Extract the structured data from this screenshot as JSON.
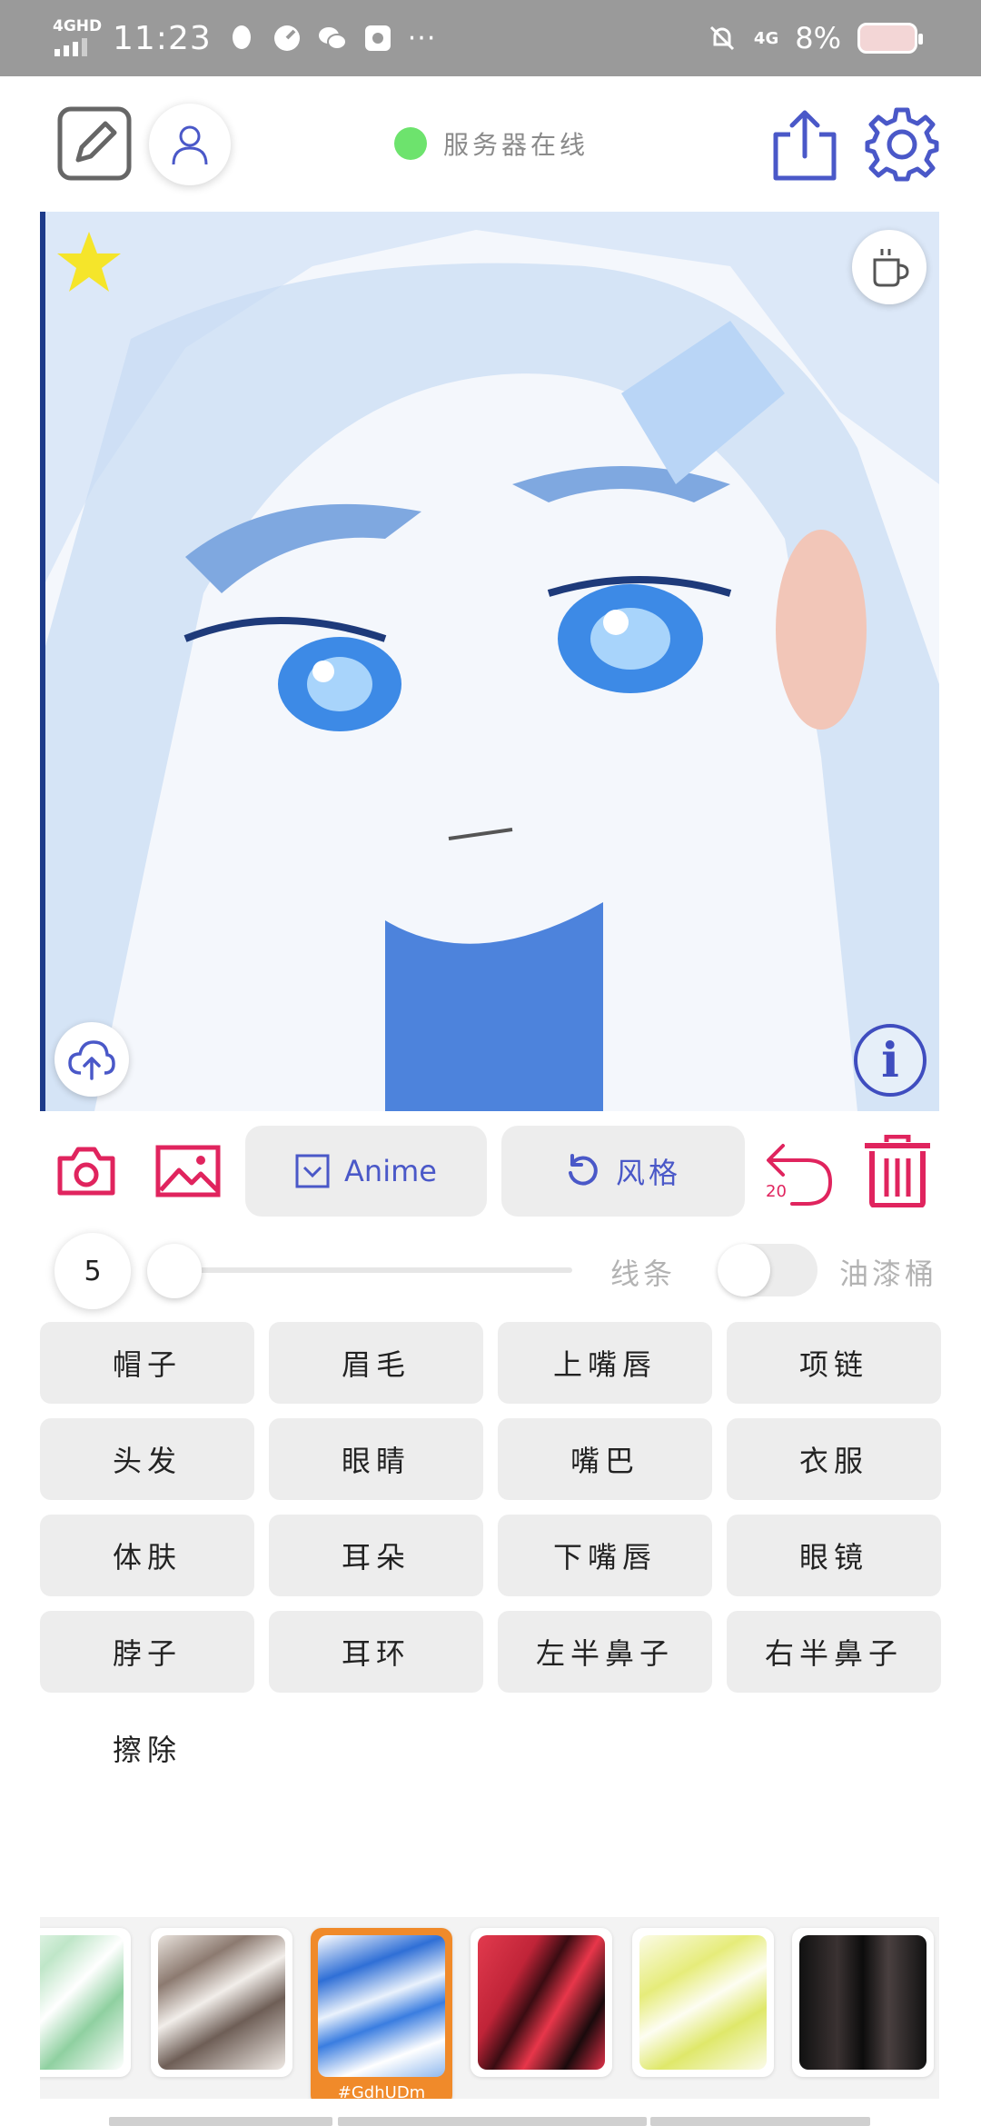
{
  "status_bar": {
    "network": "4GHD",
    "time": "11:23",
    "more": "···",
    "network_right": "4G",
    "battery": "8%"
  },
  "header": {
    "server_status": "服务器在线",
    "server_status_color": "#6de36d"
  },
  "toolbar": {
    "anime_label": "Anime",
    "style_label": "风格",
    "undo_count": "20"
  },
  "brush": {
    "size": "5",
    "lines_label": "线条",
    "bucket_label": "油漆桶",
    "bucket_enabled": false
  },
  "labels": [
    "帽子",
    "眉毛",
    "上嘴唇",
    "项链",
    "头发",
    "眼睛",
    "嘴巴",
    "衣服",
    "体肤",
    "耳朵",
    "下嘴唇",
    "眼镜",
    "脖子",
    "耳环",
    "左半鼻子",
    "右半鼻子",
    "擦除"
  ],
  "styles": {
    "selected_caption": "#GdhUDm"
  },
  "colors": {
    "accent_blue": "#4a58c8",
    "accent_red": "#e0245e",
    "selected_orange": "#f08a2a",
    "star": "#f5e52a"
  }
}
